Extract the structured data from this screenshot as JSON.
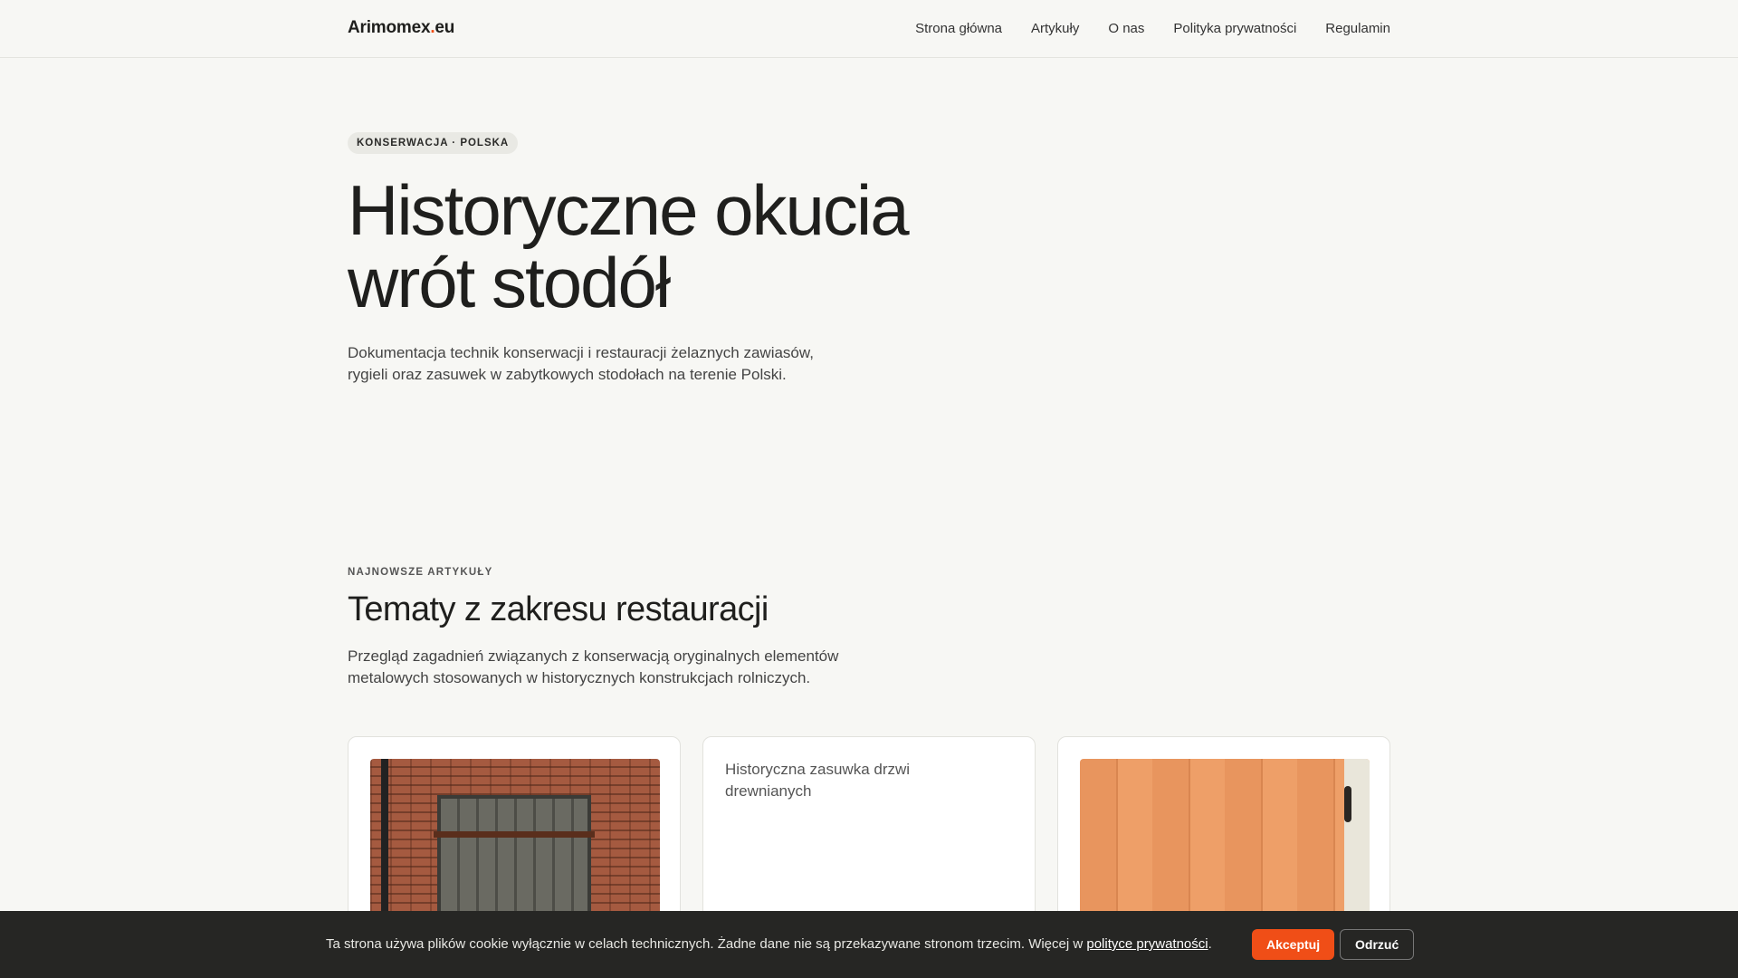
{
  "header": {
    "brand_name": "Arimomex",
    "brand_dot": ".",
    "brand_tld": "eu",
    "nav": [
      "Strona główna",
      "Artykuły",
      "O nas",
      "Polityka prywatności",
      "Regulamin"
    ]
  },
  "hero": {
    "tag": "KONSERWACJA · POLSKA",
    "title_line1": "Historyczne okucia",
    "title_line2": "wrót stodół",
    "description": "Dokumentacja technik konserwacji i restauracji żelaznych zawiasów, rygieli oraz zasuwek w zabytkowych stodołach na terenie Polski."
  },
  "articles": {
    "eyebrow": "NAJNOWSZE ARTYKUŁY",
    "title": "Tematy z zakresu restauracji",
    "lead": "Przegląd zagadnień związanych z konserwacją oryginalnych elementów metalowych stosowanych w historycznych konstrukcjach rolniczych.",
    "cards": [
      {
        "image": "brick-barn-door-photo"
      },
      {
        "image_alt": "Historyczna zasuwka drzwi drewnianych"
      },
      {
        "image": "wooden-door-iron-strip-photo"
      }
    ]
  },
  "cookie": {
    "message": "Ta strona używa plików cookie wyłącznie w celach technicznych. Żadne dane nie są przekazywane stronom trzecim. Więcej w ",
    "link": "polityce prywatności",
    "suffix": ".",
    "accept": "Akceptuj",
    "reject": "Odrzuć"
  },
  "colors": {
    "accent": "#f04e17",
    "background": "#f7f7f4",
    "cookie_bar": "#262624"
  }
}
